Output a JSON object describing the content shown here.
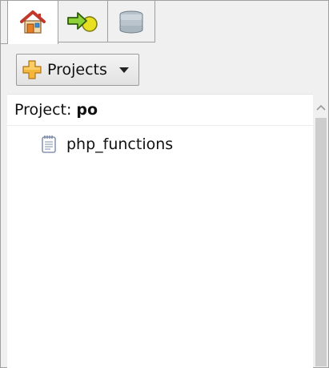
{
  "tabs": [
    {
      "icon": "home-icon",
      "active": true
    },
    {
      "icon": "run-arrow-icon",
      "active": false
    },
    {
      "icon": "database-icon",
      "active": false
    }
  ],
  "toolbar": {
    "projects_label": "Projects",
    "plus_icon": "add-project-icon",
    "dropdown_icon": "chevron-down-icon"
  },
  "project": {
    "label": "Project:",
    "name": "po"
  },
  "tree": {
    "items": [
      {
        "label": "php_functions",
        "icon": "file-icon"
      }
    ]
  }
}
